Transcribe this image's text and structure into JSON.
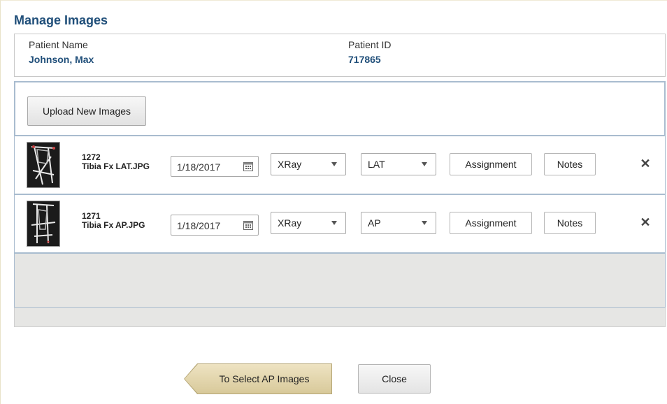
{
  "title": "Manage Images",
  "patient": {
    "name_label": "Patient Name",
    "name_value": "Johnson, Max",
    "id_label": "Patient ID",
    "id_value": "717865"
  },
  "upload_button": "Upload New Images",
  "images": [
    {
      "id": "1272",
      "filename": "Tibia Fx LAT.JPG",
      "date": "1/18/2017",
      "modality": "XRay",
      "view": "LAT",
      "assignment_label": "Assignment",
      "notes_label": "Notes",
      "remove_label": "✕"
    },
    {
      "id": "1271",
      "filename": "Tibia Fx AP.JPG",
      "date": "1/18/2017",
      "modality": "XRay",
      "view": "AP",
      "assignment_label": "Assignment",
      "notes_label": "Notes",
      "remove_label": "✕"
    }
  ],
  "footer": {
    "back_button": "To Select AP Images",
    "close_button": "Close"
  },
  "colors": {
    "title": "#1f4e79",
    "panel_border": "#a9bccf",
    "nav_button": "#d8c99a"
  }
}
